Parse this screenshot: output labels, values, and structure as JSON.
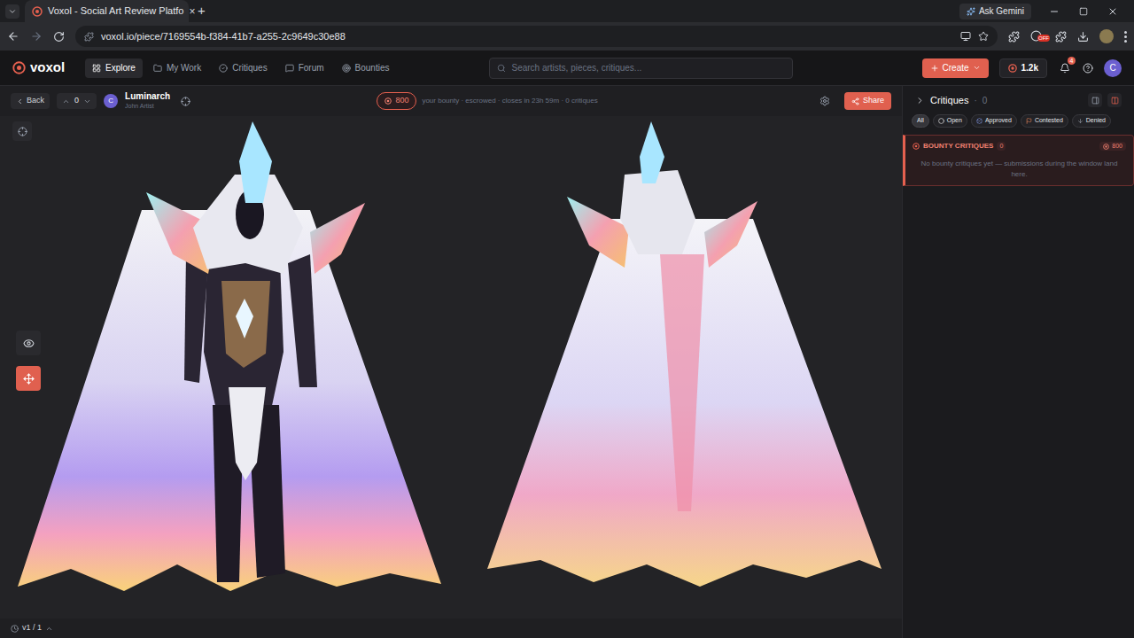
{
  "browser": {
    "tab_title": "Voxol - Social Art Review Platfo",
    "tab_close": "×",
    "new_tab": "+",
    "ask_gemini": "Ask Gemini",
    "url": "voxol.io/piece/7169554b-f384-41b7-a255-2c9649c30e88",
    "extension_badge": "OFF"
  },
  "app": {
    "logo": "voxol",
    "nav": [
      {
        "label": "Explore",
        "selected": true
      },
      {
        "label": "My Work",
        "selected": false
      },
      {
        "label": "Critiques",
        "selected": false
      },
      {
        "label": "Forum",
        "selected": false
      },
      {
        "label": "Bounties",
        "selected": false
      }
    ],
    "search": {
      "placeholder": "Search artists, pieces, critiques..."
    },
    "create": "Create",
    "coins": "1.2k",
    "notifications": "4",
    "avatar": "C"
  },
  "toolbar": {
    "back": "Back",
    "votes": "0",
    "avatar": "C",
    "title": "Luminarch",
    "artist": "John Artist",
    "bounty_amount": "800",
    "bounty_info": "your bounty · escrowed · closes in 23h 59m · 0 critiques",
    "share": "Share"
  },
  "canvas": {
    "tools": [
      {
        "kind": "eye",
        "selected": false
      },
      {
        "kind": "move",
        "selected": true
      }
    ],
    "version": "v1 / 1"
  },
  "critiques": {
    "title": "Critiques",
    "separator": "·",
    "count": "0",
    "filters": [
      {
        "label": "All",
        "selected": true,
        "color": "#9ca3af"
      },
      {
        "label": "Open",
        "selected": false,
        "color": "#ffffff"
      },
      {
        "label": "Approved",
        "selected": false,
        "color": "#8fa8ff"
      },
      {
        "label": "Contested",
        "selected": false,
        "color": "#f08a5d"
      },
      {
        "label": "Denied",
        "selected": false,
        "color": "#9ca3af"
      }
    ],
    "bounty": {
      "title": "BOUNTY CRITIQUES",
      "count": "0",
      "amount": "800",
      "empty": "No bounty critiques yet — submissions during the window land here."
    }
  }
}
